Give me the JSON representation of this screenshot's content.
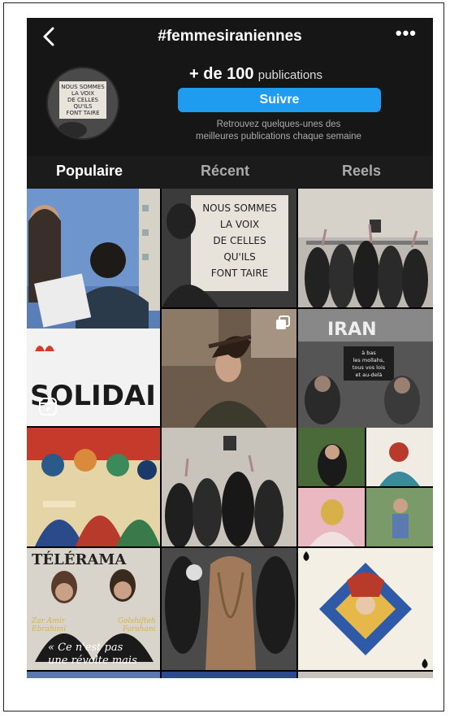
{
  "header": {
    "title": "#femmesiraniennes",
    "back_icon": "chevron-left-icon",
    "more_label": "•••"
  },
  "profile": {
    "count_bold": "+ de 100",
    "count_suffix": "publications",
    "follow_label": "Suivre",
    "description_line1": "Retrouvez quelques-unes des",
    "description_line2": "meilleures publications chaque semaine",
    "avatar_sign_lines": [
      "NOUS SOMMES",
      "LA VOIX",
      "DE CELLES",
      "QU'ILS",
      "FONT TAIRE"
    ]
  },
  "tabs": [
    {
      "label": "Populaire",
      "active": true
    },
    {
      "label": "Récent",
      "active": false
    },
    {
      "label": "Reels",
      "active": false
    }
  ],
  "posts": {
    "protest_banner_text": "SOLIDAI",
    "sign_lines": [
      "NOUS SOMMES",
      "LA VOIX",
      "DE CELLES",
      "QU'ILS",
      "FONT TAIRE"
    ],
    "iran_sign_title": "IRAN",
    "iran_sign_lines": [
      "à bas",
      "les mollahs,",
      "tous vos lois",
      "et au-delà"
    ],
    "magazine_masthead": "TÉLÉRAMA",
    "magazine_name_left_1": "Zar Amir",
    "magazine_name_left_2": "Ebrahimi",
    "magazine_name_right_1": "Golshifteh",
    "magazine_name_right_2": "Farahani",
    "magazine_quote_1": "« Ce n'est pas",
    "magazine_quote_2": "une révolte mais",
    "reel_icon": "reels-icon",
    "multi_icon": "carousel-icon"
  },
  "colors": {
    "app_bg": "#161616",
    "accent": "#1f9bf0"
  }
}
